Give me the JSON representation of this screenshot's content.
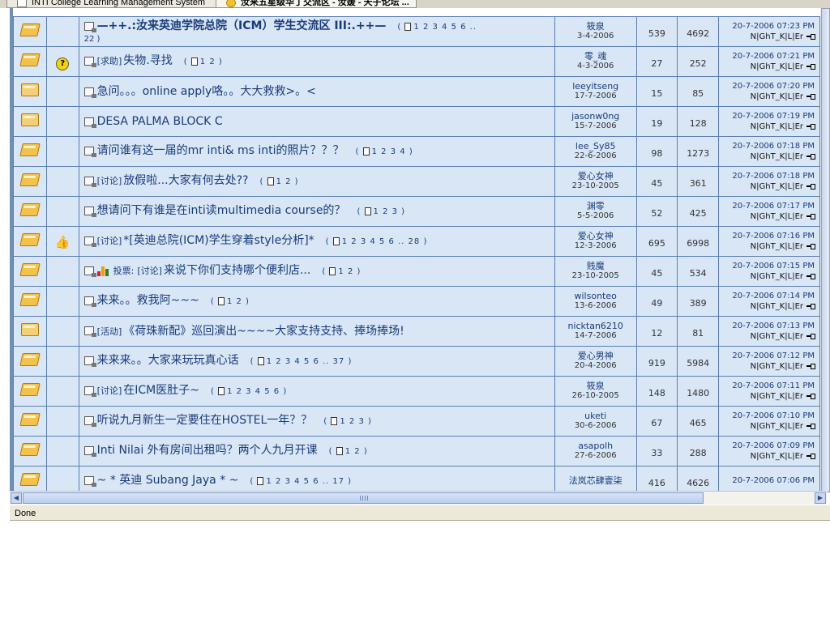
{
  "tabs": [
    {
      "label": "INTI College Learning Management System",
      "active": false
    },
    {
      "label": "汝来五星级华丁交流区 - 汝媛 - 天子论坛 ...",
      "active": true
    }
  ],
  "rows": [
    {
      "folder": "hot",
      "marker": "",
      "tag": "",
      "title": "—++.:汝来英迪学院总院（ICM）学生交流区 III:.++—",
      "bold": true,
      "pages": "1 2 3 4 5 6 ..",
      "pages_wrap": "22 )",
      "author": "筱泉",
      "date": "3-4-2006",
      "replies": "539",
      "views": "4692",
      "last_time": "20-7-2006 07:23 PM",
      "last_by": "N|GhT_K|L|Er"
    },
    {
      "folder": "hot",
      "marker": "question",
      "tag": "[求助]",
      "title": "失物.寻找",
      "pages": "1 2",
      "author": "零_魂",
      "date": "4-3-2006",
      "replies": "27",
      "views": "252",
      "last_time": "20-7-2006 07:21 PM",
      "last_by": "N|GhT_K|L|Er"
    },
    {
      "folder": "plain",
      "marker": "",
      "tag": "",
      "title": "急问。。。online apply咯。。大大救救>。<",
      "pages": "",
      "author": "leeyitseng",
      "date": "17-7-2006",
      "replies": "15",
      "views": "85",
      "last_time": "20-7-2006 07:20 PM",
      "last_by": "N|GhT_K|L|Er"
    },
    {
      "folder": "plain",
      "marker": "",
      "tag": "",
      "title": "DESA PALMA BLOCK C",
      "pages": "",
      "author": "jasonw0ng",
      "date": "15-7-2006",
      "replies": "19",
      "views": "128",
      "last_time": "20-7-2006 07:19 PM",
      "last_by": "N|GhT_K|L|Er"
    },
    {
      "folder": "hot",
      "marker": "",
      "tag": "",
      "title": "请问谁有这一届的mr inti& ms inti的照片？？？",
      "pages": "1 2 3 4",
      "author": "lee_Sy85",
      "date": "22-6-2006",
      "replies": "98",
      "views": "1273",
      "last_time": "20-7-2006 07:18 PM",
      "last_by": "N|GhT_K|L|Er"
    },
    {
      "folder": "hot",
      "marker": "",
      "tag": "[讨论]",
      "title": "放假啦...大家有何去处??",
      "pages": "1 2",
      "author": "爱心女神",
      "date": "23-10-2005",
      "replies": "45",
      "views": "361",
      "last_time": "20-7-2006 07:18 PM",
      "last_by": "N|GhT_K|L|Er"
    },
    {
      "folder": "hot",
      "marker": "",
      "tag": "",
      "title": "想请问下有谁是在inti读multimedia course的？",
      "pages": "1 2 3",
      "author": "渊零",
      "date": "5-5-2006",
      "replies": "52",
      "views": "425",
      "last_time": "20-7-2006 07:17 PM",
      "last_by": "N|GhT_K|L|Er"
    },
    {
      "folder": "hot",
      "marker": "thumb",
      "tag": "[讨论]",
      "title": "*[英迪总院(ICM)学生穿着style分析]*",
      "pages": "1 2 3 4 5 6 .. 28",
      "author": "爱心女神",
      "date": "12-3-2006",
      "replies": "695",
      "views": "6998",
      "last_time": "20-7-2006 07:16 PM",
      "last_by": "N|GhT_K|L|Er"
    },
    {
      "folder": "hot",
      "marker": "",
      "vote": "投票:",
      "tag": "[讨论]",
      "title": "来说下你们支持哪个便利店...",
      "pages": "1 2",
      "author": "贱魔",
      "date": "23-10-2005",
      "replies": "45",
      "views": "534",
      "last_time": "20-7-2006 07:15 PM",
      "last_by": "N|GhT_K|L|Er"
    },
    {
      "folder": "hot",
      "marker": "",
      "tag": "",
      "title": "来来。。救我阿~~~",
      "pages": "1 2",
      "author": "wilsonteo",
      "date": "13-6-2006",
      "replies": "49",
      "views": "389",
      "last_time": "20-7-2006 07:14 PM",
      "last_by": "N|GhT_K|L|Er"
    },
    {
      "folder": "plain",
      "marker": "",
      "tag": "[活动]",
      "title": "《荷珠新配》巡回演出~~~~大家支持支持、捧场捧场!",
      "pages": "",
      "author": "nicktan6210",
      "date": "14-7-2006",
      "replies": "12",
      "views": "81",
      "last_time": "20-7-2006 07:13 PM",
      "last_by": "N|GhT_K|L|Er"
    },
    {
      "folder": "hot",
      "marker": "",
      "tag": "",
      "title": "来来来。。大家来玩玩真心话",
      "pages": "1 2 3 4 5 6 .. 37",
      "author": "爱心男神",
      "date": "20-4-2006",
      "replies": "919",
      "views": "5984",
      "last_time": "20-7-2006 07:12 PM",
      "last_by": "N|GhT_K|L|Er"
    },
    {
      "folder": "hot",
      "marker": "",
      "tag": "[讨论]",
      "title": "在ICM医肚子~",
      "pages": "1 2 3 4 5 6",
      "author": "筱泉",
      "date": "26-10-2005",
      "replies": "148",
      "views": "1480",
      "last_time": "20-7-2006 07:11 PM",
      "last_by": "N|GhT_K|L|Er"
    },
    {
      "folder": "hot",
      "marker": "",
      "tag": "",
      "title": "听说九月新生一定要住在HOSTEL一年？？",
      "pages": "1 2 3",
      "author": "uketi",
      "date": "30-6-2006",
      "replies": "67",
      "views": "465",
      "last_time": "20-7-2006 07:10 PM",
      "last_by": "N|GhT_K|L|Er"
    },
    {
      "folder": "hot",
      "marker": "",
      "tag": "",
      "title": "Inti Nilai 外有房间出租吗？两个人九月开课",
      "pages": "1 2",
      "author": "asapolh",
      "date": "27-6-2006",
      "replies": "33",
      "views": "288",
      "last_time": "20-7-2006 07:09 PM",
      "last_by": "N|GhT_K|L|Er"
    },
    {
      "folder": "hot",
      "marker": "",
      "tag": "",
      "title": "~ * 英迪 Subang Jaya * ~",
      "pages": "1 2 3 4 5 6 .. 17",
      "author": "法岚芯肆壹柒",
      "date": "",
      "replies": "416",
      "views": "4626",
      "last_time": "20-7-2006 07:06 PM",
      "last_by": ""
    }
  ],
  "status_text": "Done",
  "colors": {
    "cell_bg": "#d8e6f6",
    "border": "#5a7fb0",
    "link": "#1a3c7a"
  }
}
